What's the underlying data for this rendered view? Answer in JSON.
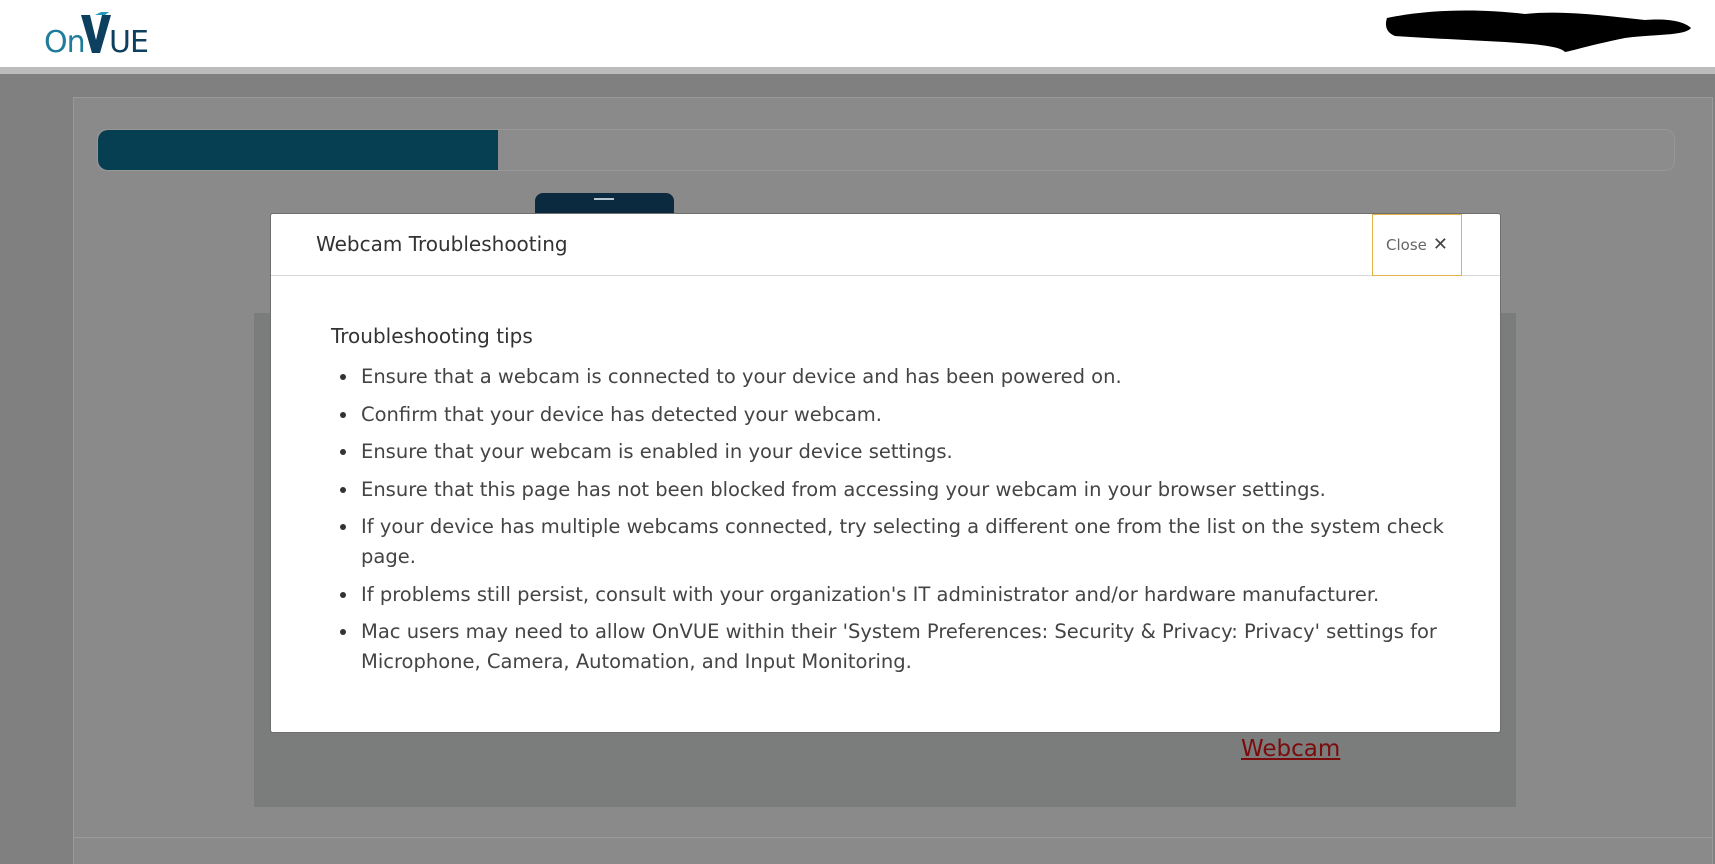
{
  "header": {
    "logo": {
      "text_on": "On",
      "text_v": "V",
      "text_ue": "UE"
    }
  },
  "page": {
    "progress": {
      "percent": 25.4
    },
    "background_link": "Webcam"
  },
  "modal": {
    "title": "Webcam Troubleshooting",
    "close_label": "Close",
    "section_heading": "Troubleshooting tips",
    "tips": [
      "Ensure that a webcam is connected to your device and has been powered on.",
      "Confirm that your device has detected your webcam.",
      "Ensure that your webcam is enabled in your device settings.",
      "Ensure that this page has not been blocked from accessing your webcam in your browser settings.",
      "If your device has multiple webcams connected, try selecting a different one from the list on the system check page.",
      "If problems still persist, consult with your organization's IT administrator and/or hardware manufacturer.",
      "Mac users may need to allow OnVUE within their 'System Preferences: Security & Privacy: Privacy' settings for Microphone, Camera, Automation, and Input Monitoring."
    ]
  },
  "colors": {
    "brand_teal": "#1f7c9a",
    "brand_navy": "#0d3f5e",
    "progress_fill": "#073f52",
    "close_border": "#e6b04a",
    "link": "#7a0c0c"
  },
  "icons": {
    "close": "close-icon",
    "logo_check": "checkmark-v-icon"
  }
}
